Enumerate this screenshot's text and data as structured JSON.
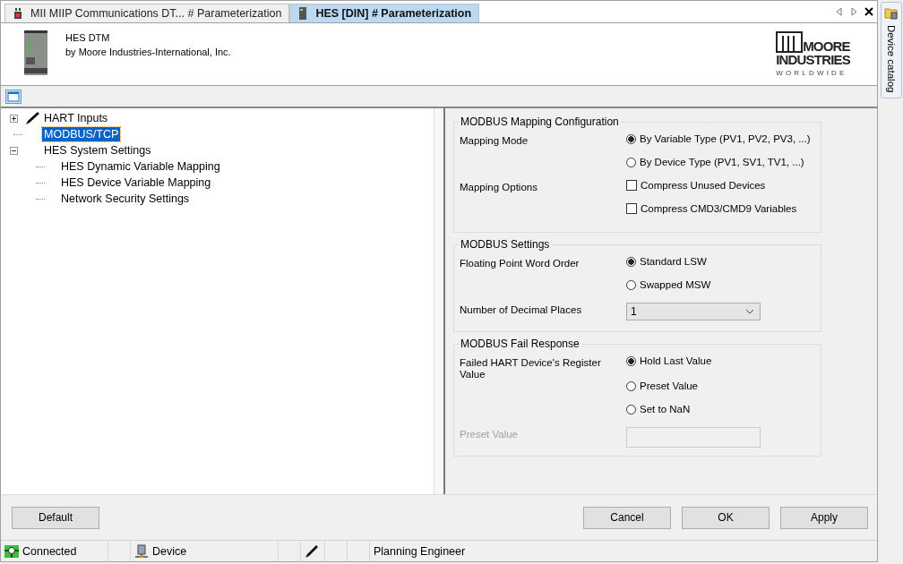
{
  "tabs": [
    {
      "label": "MII MIIP Communications DT... # Parameterization",
      "selected": false
    },
    {
      "label": "HES [DIN] # Parameterization",
      "selected": true
    }
  ],
  "header": {
    "title": "HES DTM",
    "vendor": "by Moore Industries-International, Inc.",
    "logo": [
      "MOORE",
      "INDUSTRIES",
      "WORLDWIDE"
    ]
  },
  "side_panel": {
    "label": "Device catalog"
  },
  "tree": [
    {
      "label": "HART Inputs",
      "selected": false,
      "expanded": false,
      "kind": "pencil"
    },
    {
      "label": "MODBUS/TCP",
      "selected": true
    },
    {
      "label": "HES System Settings",
      "selected": false,
      "expanded": true,
      "children": [
        {
          "label": "HES Dynamic Variable Mapping",
          "selected": false
        },
        {
          "label": "HES Device Variable Mapping",
          "selected": false
        },
        {
          "label": "Network Security Settings",
          "selected": false
        }
      ]
    }
  ],
  "groups": [
    {
      "title": "MODBUS Mapping Configuration",
      "rows": [
        {
          "label": "Mapping Mode",
          "kind": "radio",
          "text": "By Variable Type (PV1, PV2, PV3, ...)",
          "selected": true
        },
        {
          "kind": "radio",
          "text": "By Device Type (PV1, SV1, TV1, ...)",
          "selected": false
        },
        {
          "label": "Mapping Options",
          "kind": "checkbox",
          "text": "Compress Unused Devices",
          "checked": false
        },
        {
          "kind": "checkbox",
          "text": "Compress CMD3/CMD9 Variables",
          "checked": false
        }
      ]
    },
    {
      "title": "MODBUS Settings",
      "rows": [
        {
          "label": "Floating Point Word Order",
          "kind": "radio",
          "text": "Standard LSW",
          "selected": true
        },
        {
          "kind": "radio",
          "text": "Swapped MSW",
          "selected": false
        },
        {
          "label": "Number of Decimal Places",
          "kind": "dropdown",
          "value": "1"
        }
      ]
    },
    {
      "title": "MODBUS Fail Response",
      "rows": [
        {
          "label": "Failed HART Device's Register Value",
          "kind": "radio",
          "text": "Hold Last Value",
          "selected": true
        },
        {
          "kind": "radio",
          "text": "Preset Value",
          "selected": false
        },
        {
          "kind": "radio",
          "text": "Set to NaN",
          "selected": false
        },
        {
          "label": "Preset Value",
          "kind": "input",
          "disabled": true
        }
      ]
    }
  ],
  "buttons_left": [
    "Default"
  ],
  "buttons_right": [
    "Cancel",
    "OK",
    "Apply"
  ],
  "status_bar": [
    {
      "kind": "connected",
      "text": "Connected"
    },
    {
      "kind": "empty"
    },
    {
      "kind": "device",
      "text": "Device"
    },
    {
      "kind": "empty"
    },
    {
      "kind": "pencil"
    },
    {
      "kind": "empty"
    },
    {
      "kind": "empty"
    },
    {
      "kind": "text",
      "text": "Planning Engineer"
    }
  ]
}
